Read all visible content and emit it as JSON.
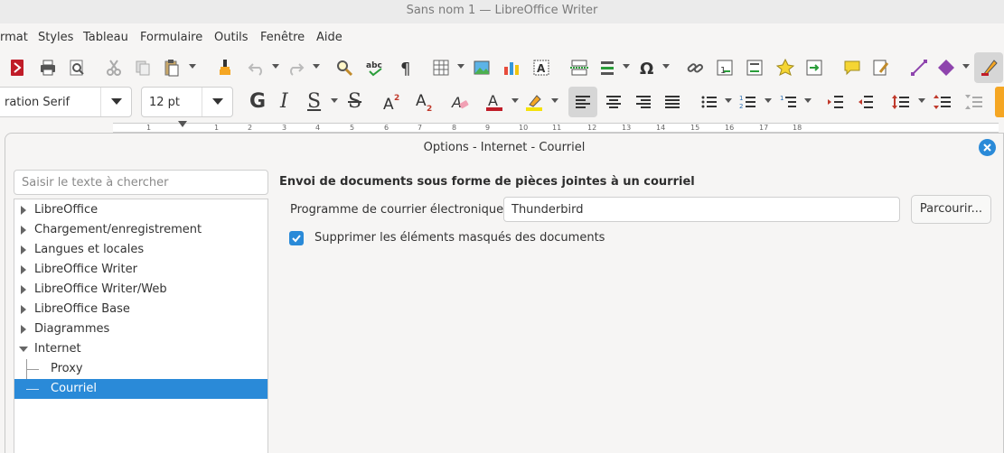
{
  "window": {
    "title": "Sans nom 1 — LibreOffice Writer"
  },
  "menubar": [
    "rmat",
    "Styles",
    "Tableau",
    "Formulaire",
    "Outils",
    "Fenêtre",
    "Aide"
  ],
  "format_toolbar": {
    "font_name": "ration Serif",
    "font_size": "12 pt"
  },
  "ruler": {
    "numbers": [
      "1",
      "1",
      "2",
      "3",
      "4",
      "5",
      "6",
      "7",
      "8",
      "9",
      "10",
      "11",
      "12",
      "13",
      "14",
      "15",
      "16",
      "17",
      "18"
    ]
  },
  "dialog": {
    "title": "Options - Internet - Courriel",
    "search_placeholder": "Saisir le texte à chercher",
    "tree": [
      {
        "label": "LibreOffice",
        "expanded": false
      },
      {
        "label": "Chargement/enregistrement",
        "expanded": false
      },
      {
        "label": "Langues et locales",
        "expanded": false
      },
      {
        "label": "LibreOffice Writer",
        "expanded": false
      },
      {
        "label": "LibreOffice Writer/Web",
        "expanded": false
      },
      {
        "label": "LibreOffice Base",
        "expanded": false
      },
      {
        "label": "Diagrammes",
        "expanded": false
      },
      {
        "label": "Internet",
        "expanded": true
      },
      {
        "label": "Proxy",
        "child": true
      },
      {
        "label": "Courriel",
        "child": true,
        "selected": true
      }
    ],
    "section_title": "Envoi de documents sous forme de pièces jointes à un courriel",
    "program_label": "Programme de courrier électronique :",
    "program_value": "Thunderbird",
    "browse_label": "Parcourir...",
    "checkbox_label": "Supprimer les éléments masqués des documents",
    "checkbox_checked": true
  },
  "colors": {
    "accent": "#2a8ad8",
    "font_color": "#c01c28",
    "highlight": "#f5e20a"
  }
}
